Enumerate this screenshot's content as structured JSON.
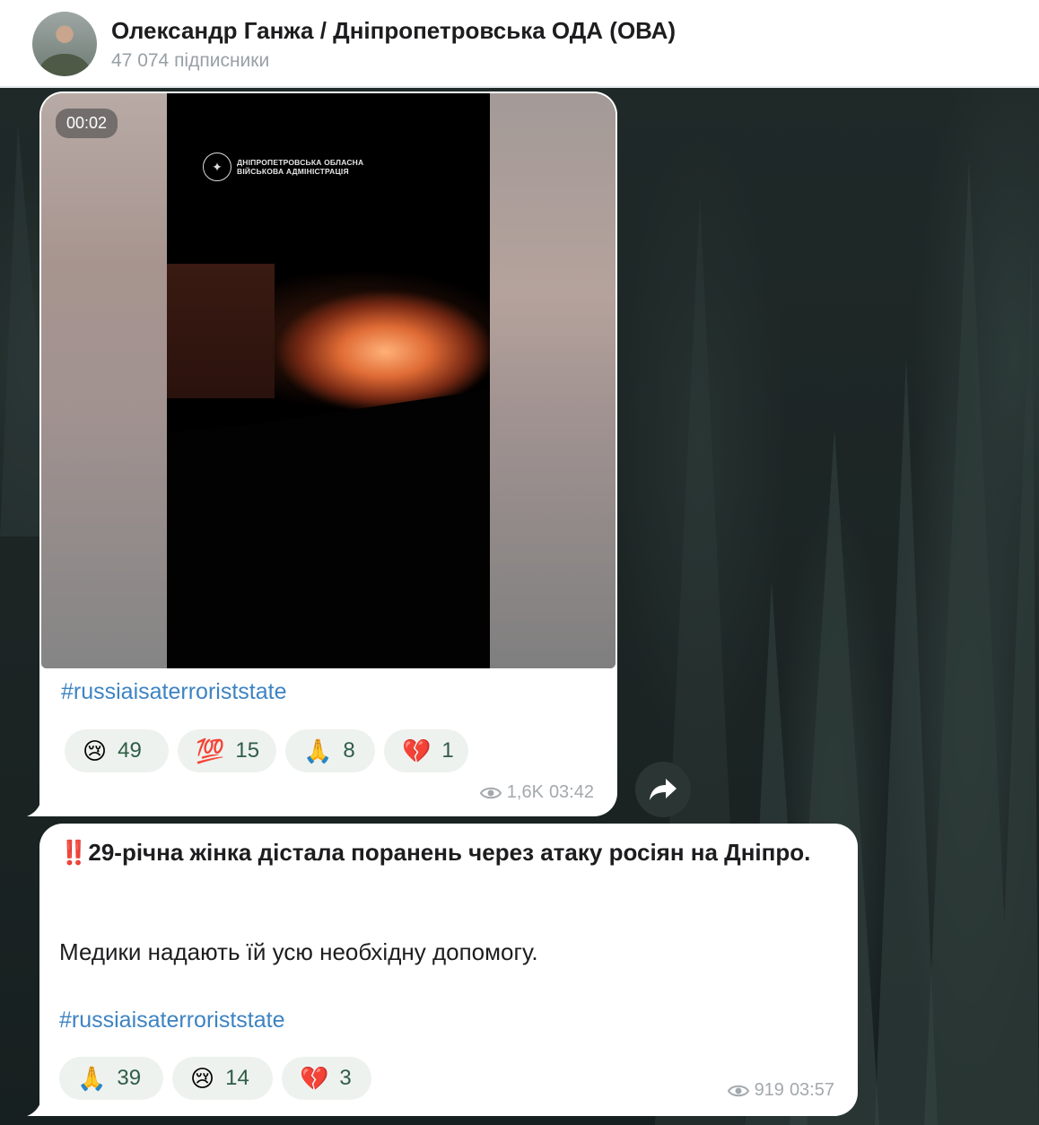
{
  "header": {
    "channel_title": "Олександр Ганжа / Дніпропетровська ОДА (ОВА)",
    "subscribers": "47 074 підписники"
  },
  "post1": {
    "video_duration": "00:02",
    "video_logo_text_line1": "ДНІПРОПЕТРОВСЬКА ОБЛАСНА",
    "video_logo_text_line2": "ВІЙСЬКОВА АДМІНІСТРАЦІЯ",
    "hashtag": "#russiaisaterroriststate",
    "reactions": [
      {
        "emoji": "😢",
        "count": "49"
      },
      {
        "emoji": "💯",
        "count": "15"
      },
      {
        "emoji": "🙏",
        "count": "8"
      },
      {
        "emoji": "💔",
        "count": "1"
      }
    ],
    "views": "1,6K",
    "time": "03:42"
  },
  "post2": {
    "title_emoji": "‼️",
    "title": "29-річна жінка дістала поранень через атаку росіян на Дніпро.",
    "body": "Медики надають їй усю необхідну допомогу.",
    "hashtag": "#russiaisaterroriststate",
    "reactions": [
      {
        "emoji": "🙏",
        "count": "39"
      },
      {
        "emoji": "😢",
        "count": "14"
      },
      {
        "emoji": "💔",
        "count": "3"
      }
    ],
    "views": "919",
    "time": "03:57"
  },
  "icons": {
    "share": "share-arrow-icon",
    "views": "eye-icon"
  },
  "colors": {
    "link": "#3d83c2",
    "reaction_bg": "#eef2ef",
    "reaction_text": "#2f5d46",
    "meta": "#a3a9ad"
  }
}
